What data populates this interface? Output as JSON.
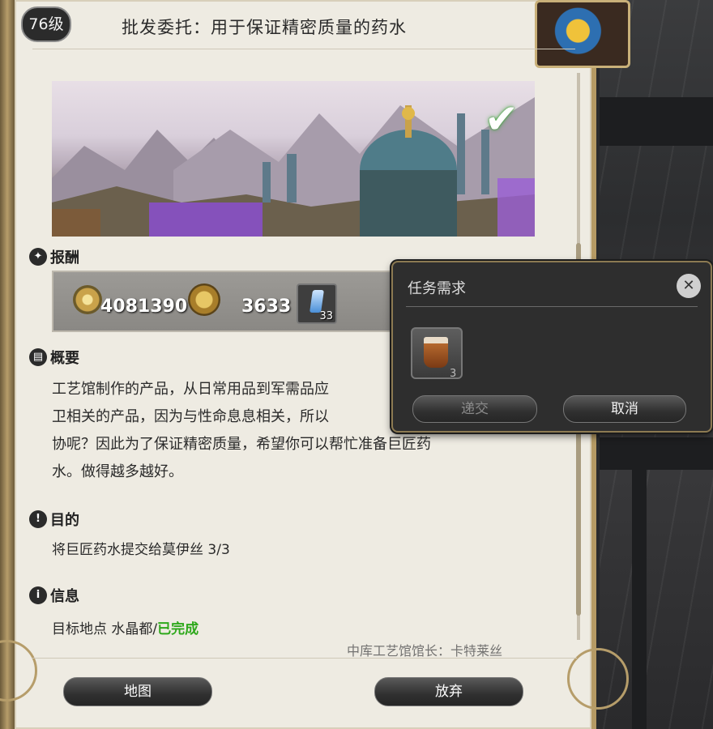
{
  "quest": {
    "level_badge": "76级",
    "title": "批发委托：用于保证精密质量的药水"
  },
  "sections": {
    "rewards": "报酬",
    "summary": "概要",
    "objective": "目的",
    "info": "信息"
  },
  "rewards": {
    "gil": "4081390",
    "seals": "3633",
    "crystal_count": "33"
  },
  "summary_lines": [
    "工艺馆制作的产品，从日常用品到军需品应",
    "卫相关的产品，因为与性命息息相关，所以",
    "协呢？因此为了保证精密质量，希望你可以帮忙准备巨匠药",
    "水。做得越多越好。"
  ],
  "objective_text": "将巨匠药水提交给莫伊丝 3/3",
  "info": {
    "location": "目标地点 水晶都/",
    "status": "已完成"
  },
  "partial_text": "中库工艺馆馆长：卡特莱丝",
  "buttons": {
    "map": "地图",
    "abandon": "放弃"
  },
  "popup": {
    "title": "任务需求",
    "item_count": "3",
    "submit": "递交",
    "cancel": "取消"
  },
  "icons": {
    "rewards": "reward-icon",
    "summary": "book-icon",
    "objective": "exclamation-icon",
    "info": "info-icon",
    "complete": "checkmark-icon",
    "close": "close-icon"
  },
  "colors": {
    "completed": "#2ea81b",
    "panel_bg": "#eeebe2",
    "popup_bg": "#2e2e2e"
  }
}
